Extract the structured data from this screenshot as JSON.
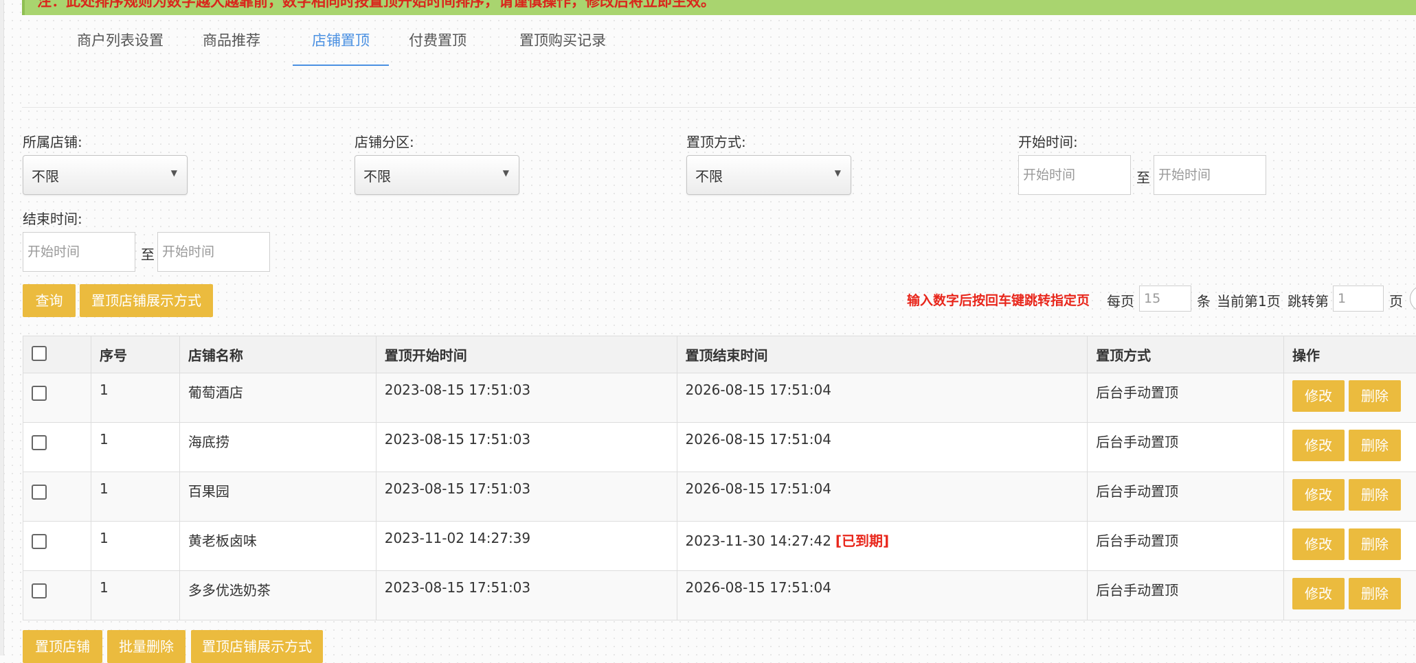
{
  "banner": {
    "text": "注：此处排序规则为数字越大越靠前，数字相同时按置顶开始时间排序，请谨慎操作，修改后将立即生效。"
  },
  "tabs": [
    {
      "label": "商户列表设置"
    },
    {
      "label": "商品推荐"
    },
    {
      "label": "店铺置顶"
    },
    {
      "label": "付费置顶"
    },
    {
      "label": "置顶购买记录"
    }
  ],
  "filters": {
    "shop": {
      "label": "所属店铺:",
      "value": "不限"
    },
    "zone": {
      "label": "店铺分区:",
      "value": "不限"
    },
    "mode": {
      "label": "置顶方式:",
      "value": "不限"
    },
    "start": {
      "label": "开始时间:",
      "from_placeholder": "开始时间",
      "to_placeholder": "开始时间",
      "sep": "至"
    },
    "end": {
      "label": "结束时间:",
      "from_placeholder": "开始时间",
      "to_placeholder": "开始时间",
      "sep": "至"
    }
  },
  "actions": {
    "query": "查询",
    "display_mode": "置顶店铺展示方式"
  },
  "pager": {
    "note": "输入数字后按回车键跳转指定页",
    "per_page_label": "每页",
    "per_page_value": "15",
    "unit": "条",
    "current_label": "当前第1页",
    "jump_label": "跳转第",
    "jump_value": "1",
    "page_unit": "页"
  },
  "table": {
    "headers": [
      "序号",
      "店铺名称",
      "置顶开始时间",
      "置顶结束时间",
      "置顶方式",
      "操作"
    ],
    "rows": [
      {
        "no": "1",
        "name": "葡萄酒店",
        "start": "2023-08-15 17:51:03",
        "end": "2026-08-15 17:51:04",
        "expired": "",
        "mode": "后台手动置顶"
      },
      {
        "no": "1",
        "name": "海底捞",
        "start": "2023-08-15 17:51:03",
        "end": "2026-08-15 17:51:04",
        "expired": "",
        "mode": "后台手动置顶"
      },
      {
        "no": "1",
        "name": "百果园",
        "start": "2023-08-15 17:51:03",
        "end": "2026-08-15 17:51:04",
        "expired": "",
        "mode": "后台手动置顶"
      },
      {
        "no": "1",
        "name": "黄老板卤味",
        "start": "2023-11-02 14:27:39",
        "end": "2023-11-30 14:27:42",
        "expired": "[已到期]",
        "mode": "后台手动置顶"
      },
      {
        "no": "1",
        "name": "多多优选奶茶",
        "start": "2023-08-15 17:51:03",
        "end": "2026-08-15 17:51:04",
        "expired": "",
        "mode": "后台手动置顶"
      }
    ],
    "edit_label": "修改",
    "delete_label": "删除"
  },
  "bottom_actions": {
    "pin": "置顶店铺",
    "batch_delete": "批量删除",
    "display_mode": "置顶店铺展示方式"
  },
  "colors": {
    "accent": "#ebbb3e",
    "tab_active": "#4a90e2",
    "alert_red": "#e8261b",
    "banner_green": "#a9d46f"
  }
}
